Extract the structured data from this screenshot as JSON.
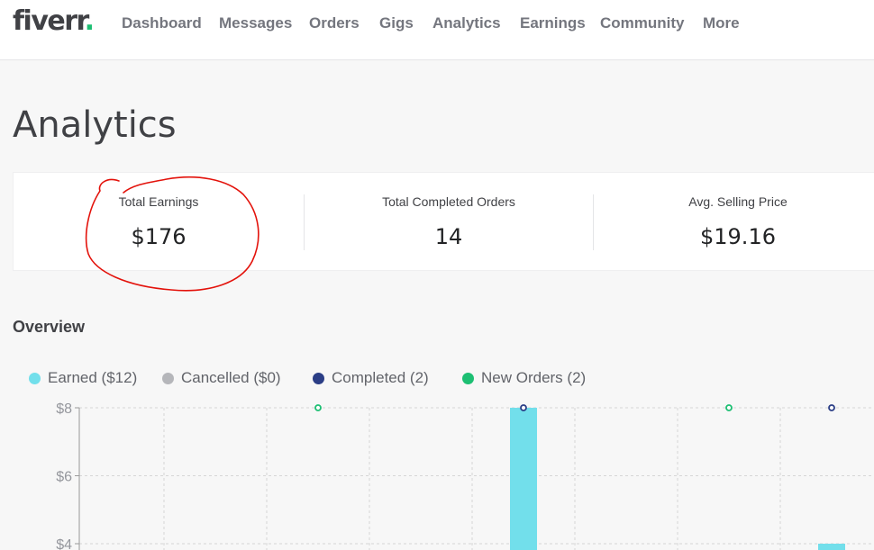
{
  "brand": {
    "logo_text": "fiverr",
    "logo_dot": "."
  },
  "nav": {
    "items": [
      {
        "label": "Dashboard"
      },
      {
        "label": "Messages"
      },
      {
        "label": "Orders"
      },
      {
        "label": "Gigs"
      },
      {
        "label": "Analytics"
      },
      {
        "label": "Earnings"
      },
      {
        "label": "Community"
      },
      {
        "label": "More"
      }
    ]
  },
  "page": {
    "title": "Analytics"
  },
  "stats": [
    {
      "label": "Total Earnings",
      "value": "$176"
    },
    {
      "label": "Total Completed Orders",
      "value": "14"
    },
    {
      "label": "Avg. Selling Price",
      "value": "$19.16"
    }
  ],
  "overview": {
    "title": "Overview",
    "legend": [
      {
        "label": "Earned ($12)",
        "color": "#72dfeb"
      },
      {
        "label": "Cancelled ($0)",
        "color": "#b5b6ba"
      },
      {
        "label": "Completed (2)",
        "color": "#2b3e86"
      },
      {
        "label": "New Orders (2)",
        "color": "#1dbf73"
      }
    ]
  },
  "chart_data": {
    "type": "bar",
    "y_tick_labels": [
      "$8",
      "$6",
      "$4"
    ],
    "ylim": [
      0,
      8
    ],
    "grid": true,
    "series": [
      {
        "name": "Earned",
        "color": "#72dfeb",
        "points": [
          {
            "slot": 4,
            "value": 8
          },
          {
            "slot": 7,
            "value": 4
          }
        ]
      },
      {
        "name": "Completed",
        "color": "#2b3e86",
        "markers": [
          {
            "slot": 4,
            "value": 8
          },
          {
            "slot": 7,
            "value": 8
          }
        ]
      },
      {
        "name": "New Orders",
        "color": "#1dbf73",
        "markers": [
          {
            "slot": 2,
            "value": 8
          },
          {
            "slot": 6,
            "value": 8
          }
        ]
      }
    ]
  },
  "annotation": {
    "color": "#e3120b"
  }
}
